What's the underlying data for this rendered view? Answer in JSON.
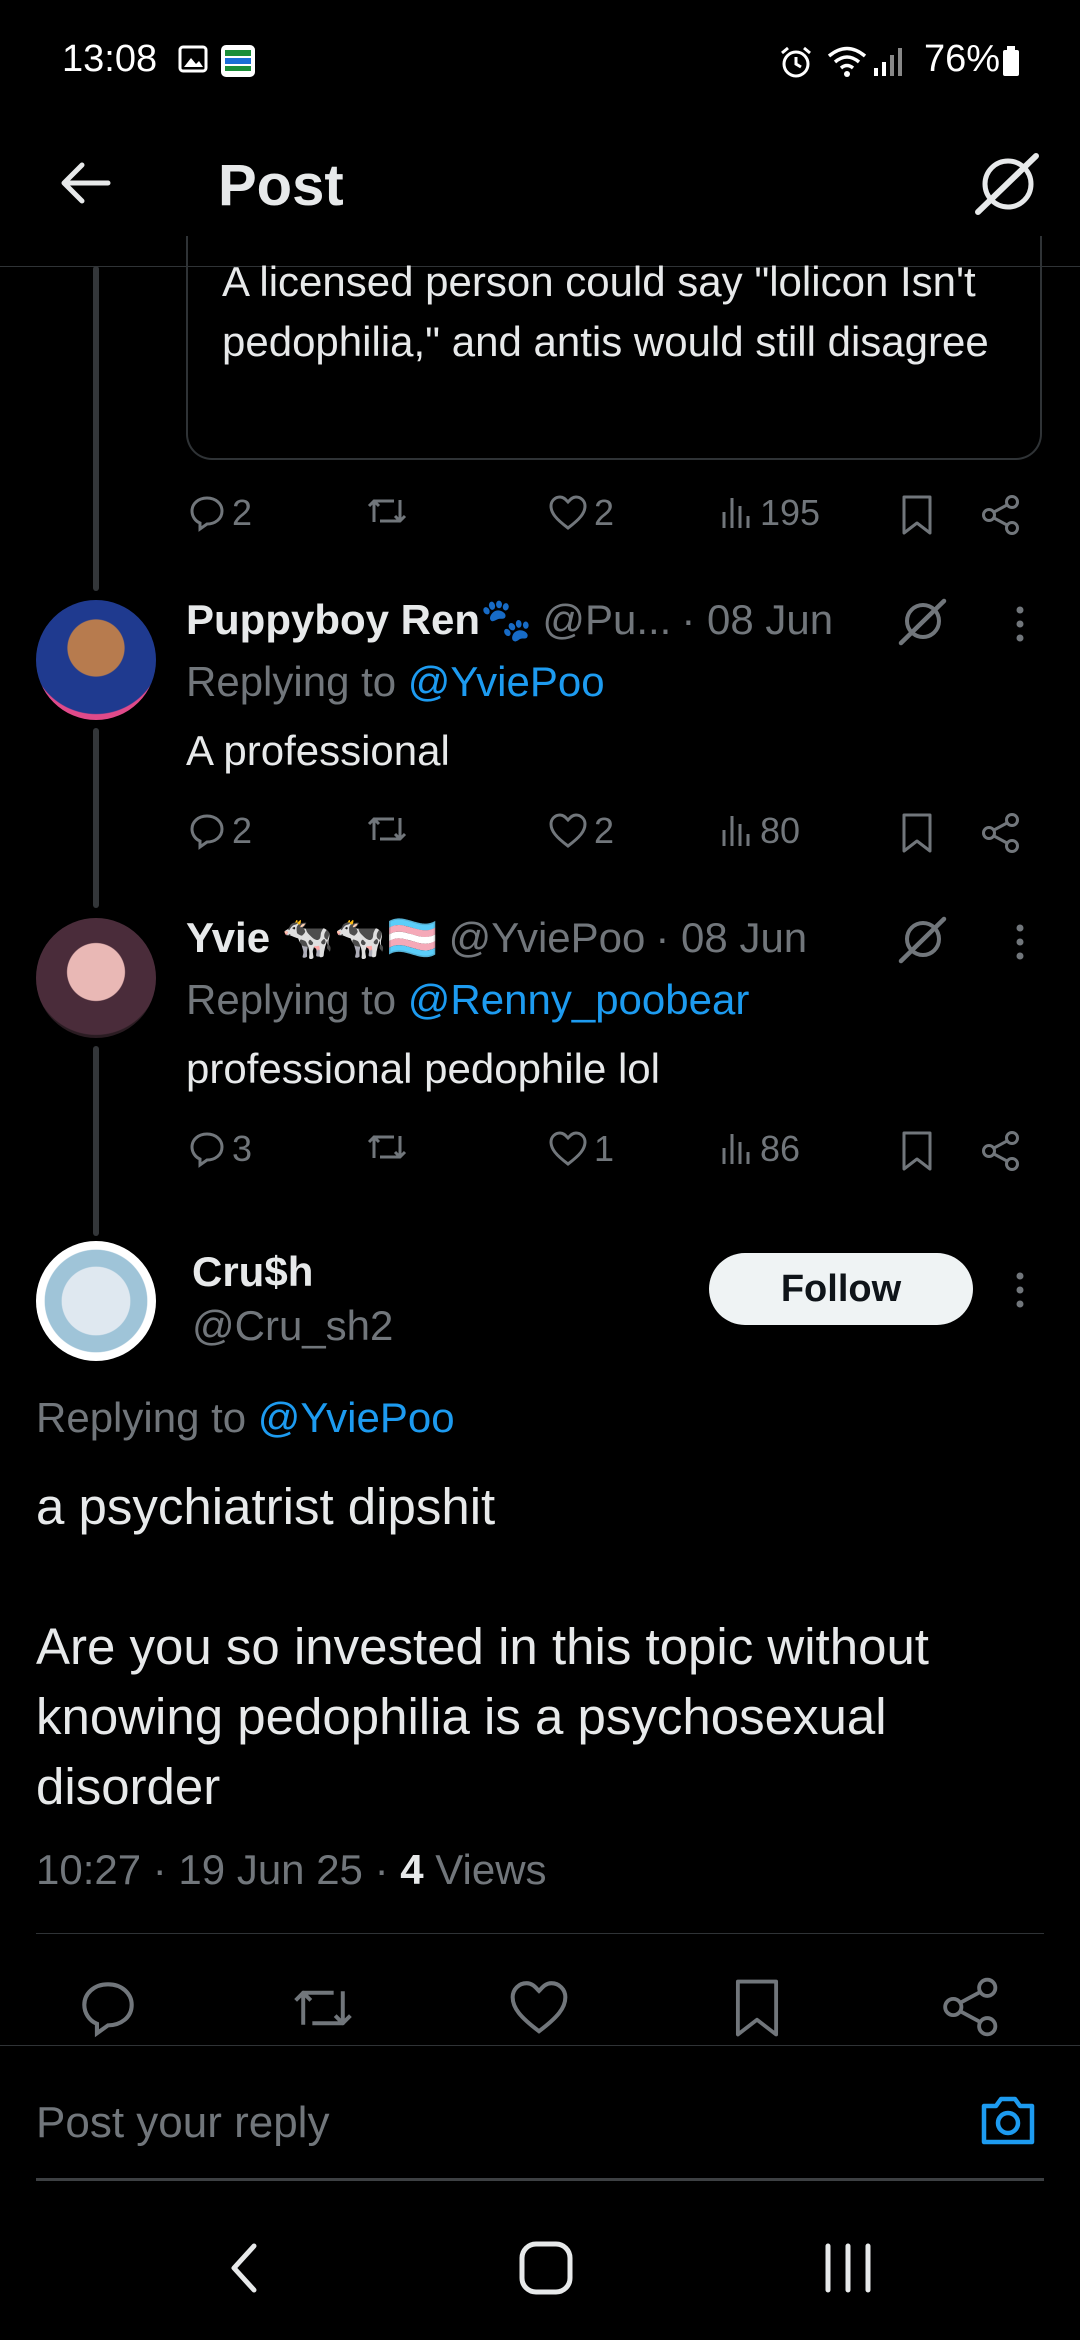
{
  "status_bar": {
    "time": "13:08",
    "battery": "76%"
  },
  "header": {
    "title": "Post"
  },
  "quoted_card": {
    "text": "A licensed person could say \"lolicon Isn't pedophilia,\" and antis would still disagree"
  },
  "quoted_actions": {
    "replies": "2",
    "likes": "2",
    "views": "195"
  },
  "replies": [
    {
      "name": "Puppyboy Ren🐾",
      "handle": "@Pu...",
      "date": "· 08 Jun",
      "replying_prefix": "Replying to",
      "replying_to": "@YviePoo",
      "text": "A professional",
      "replies": "2",
      "likes": "2",
      "views": "80"
    },
    {
      "name": "Yvie 🐄🐄🏳️‍⚧️",
      "handle": "@YviePoo",
      "date": "· 08 Jun",
      "replying_prefix": "Replying to",
      "replying_to": "@Renny_poobear",
      "text": "professional pedophile lol",
      "replies": "3",
      "likes": "1",
      "views": "86"
    }
  ],
  "main_post": {
    "name": "Cru$h",
    "handle": "@Cru_sh2",
    "follow_label": "Follow",
    "replying_prefix": "Replying to",
    "replying_to": "@YviePoo",
    "text_line1": "a psychiatrist dipshit",
    "text_line2": "Are you so invested in this topic without knowing pedophilia is a psychosexual disorder",
    "timestamp": "10:27 · 19 Jun 25 ·",
    "views_count": "4",
    "views_label": "Views"
  },
  "reply_bar": {
    "placeholder": "Post your reply"
  },
  "colors": {
    "accent": "#1d9bf0",
    "background": "#000000",
    "muted": "#71767b",
    "text": "#e7e9ea"
  }
}
